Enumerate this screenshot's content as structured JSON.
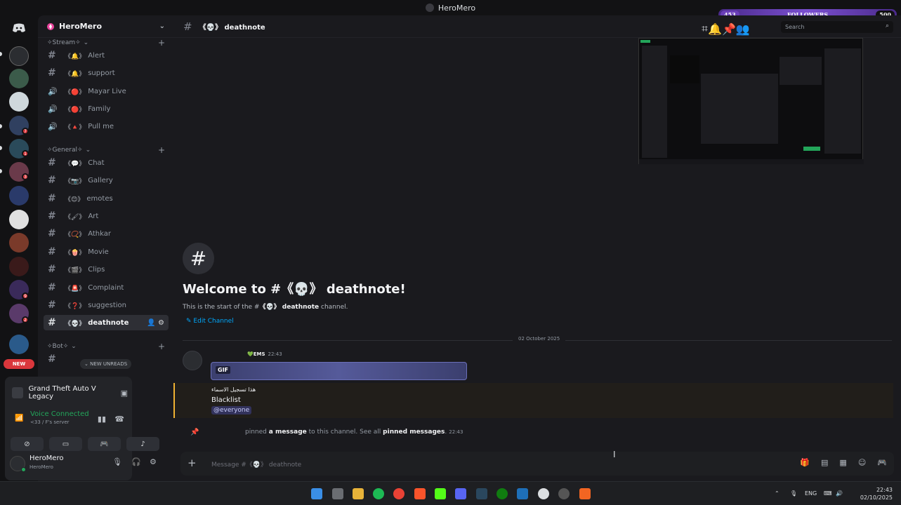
{
  "window": {
    "title": "HeroMero"
  },
  "overlay": {
    "left_count": "453",
    "label": "FOLLOWERS",
    "right_count": "500"
  },
  "rail": {
    "badges": [
      "7",
      "1",
      "3",
      "9",
      "2"
    ],
    "new_label": "NEW"
  },
  "server": {
    "name": "HeroMero",
    "categories": [
      {
        "name": "✧Stream✧"
      },
      {
        "name": "✧General✧"
      },
      {
        "name": "✧Bot✧"
      }
    ],
    "stream_channels": [
      {
        "emoji": "《🔔》",
        "name": "Alert",
        "type": "text"
      },
      {
        "emoji": "《🔔》",
        "name": "support",
        "type": "text"
      },
      {
        "emoji": "《🔴》",
        "name": "Mayar Live",
        "type": "voice"
      },
      {
        "emoji": "《🔴》",
        "name": "Family",
        "type": "voice"
      },
      {
        "emoji": "《🔺》",
        "name": "Pull me",
        "type": "voice"
      }
    ],
    "general_channels": [
      {
        "emoji": "《💬》",
        "name": "Chat"
      },
      {
        "emoji": "《📷》",
        "name": "Gallery"
      },
      {
        "emoji": "《😊》",
        "name": "emotes"
      },
      {
        "emoji": "《🖌》",
        "name": "Art"
      },
      {
        "emoji": "《📿》",
        "name": "Athkar"
      },
      {
        "emoji": "《🍿》",
        "name": "Movie"
      },
      {
        "emoji": "《🎬》",
        "name": "Clips"
      },
      {
        "emoji": "《🚨》",
        "name": "Complaint"
      },
      {
        "emoji": "《❓》",
        "name": "suggestion"
      },
      {
        "emoji": "《💀》",
        "name": "deathnote"
      }
    ],
    "new_unreads": "NEW UNREADS"
  },
  "activity": {
    "game": "Grand Theft Auto V Legacy",
    "voice_status": "Voice Connected",
    "voice_server": "<33 / F's server"
  },
  "user": {
    "name": "HeroMero",
    "status": "HeroMero"
  },
  "channel": {
    "title": "《💀》 deathnote",
    "search_placeholder": "Search",
    "welcome_title": "Welcome to #《💀》 deathnote!",
    "welcome_pre": "This is the start of the #",
    "welcome_name": "《💀》 deathnote",
    "welcome_post": " channel.",
    "edit_label": "Edit Channel",
    "date_divider": "02 October 2025"
  },
  "message": {
    "author_tag": "💚EMS",
    "time": "22:43",
    "gif_label": "GIF",
    "line1": "هذا تسجيل الاسماء",
    "line2": "Blacklist",
    "mention": "@everyone"
  },
  "pin": {
    "pre": "pinned ",
    "link1": "a message",
    "mid": " to this channel. See all ",
    "link2": "pinned messages",
    "post": ".",
    "time": "22:43"
  },
  "composer": {
    "placeholder": "Message #《💀》 deathnote"
  },
  "taskbar": {
    "lang": "ENG",
    "time": "22:43",
    "date": "02/10/2025"
  },
  "colors": {
    "accent": "#5865f2",
    "online": "#23a55a",
    "mention_bar": "#f0b232",
    "link": "#00a8fc"
  }
}
